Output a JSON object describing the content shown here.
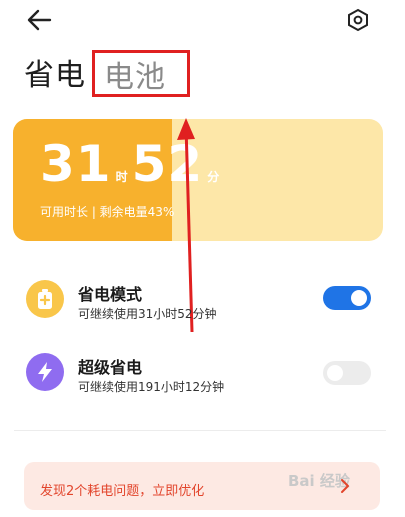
{
  "header": {
    "back_icon": "arrow-left-icon",
    "settings_icon": "gear-icon"
  },
  "tabs": [
    {
      "label": "省电",
      "active": true
    },
    {
      "label": "电池",
      "active": false
    }
  ],
  "battery_card": {
    "hours": "31",
    "hours_unit": "时",
    "minutes": "52",
    "minutes_unit": "分",
    "subtitle": "可用时长 | 剩余电量43%",
    "level_percent": 43,
    "fill_color": "#f7b12d",
    "track_color": "#fde7a8"
  },
  "modes": [
    {
      "title": "省电模式",
      "subtitle": "可继续使用31小时52分钟",
      "icon": "battery-plus-icon",
      "icon_bg": "#f9c64a",
      "enabled": true
    },
    {
      "title": "超级省电",
      "subtitle": "可继续使用191小时12分钟",
      "icon": "lightning-icon",
      "icon_bg": "#8f6cf0",
      "enabled": false
    }
  ],
  "colors": {
    "toggle_on": "#1f74e6",
    "toggle_off": "#ececec",
    "annotation_red": "#e02020"
  },
  "suggestion": {
    "text": "发现2个耗电问题，立即优化",
    "chevron_icon": "chevron-right-icon"
  },
  "watermark": {
    "text": "Bai 经验"
  }
}
